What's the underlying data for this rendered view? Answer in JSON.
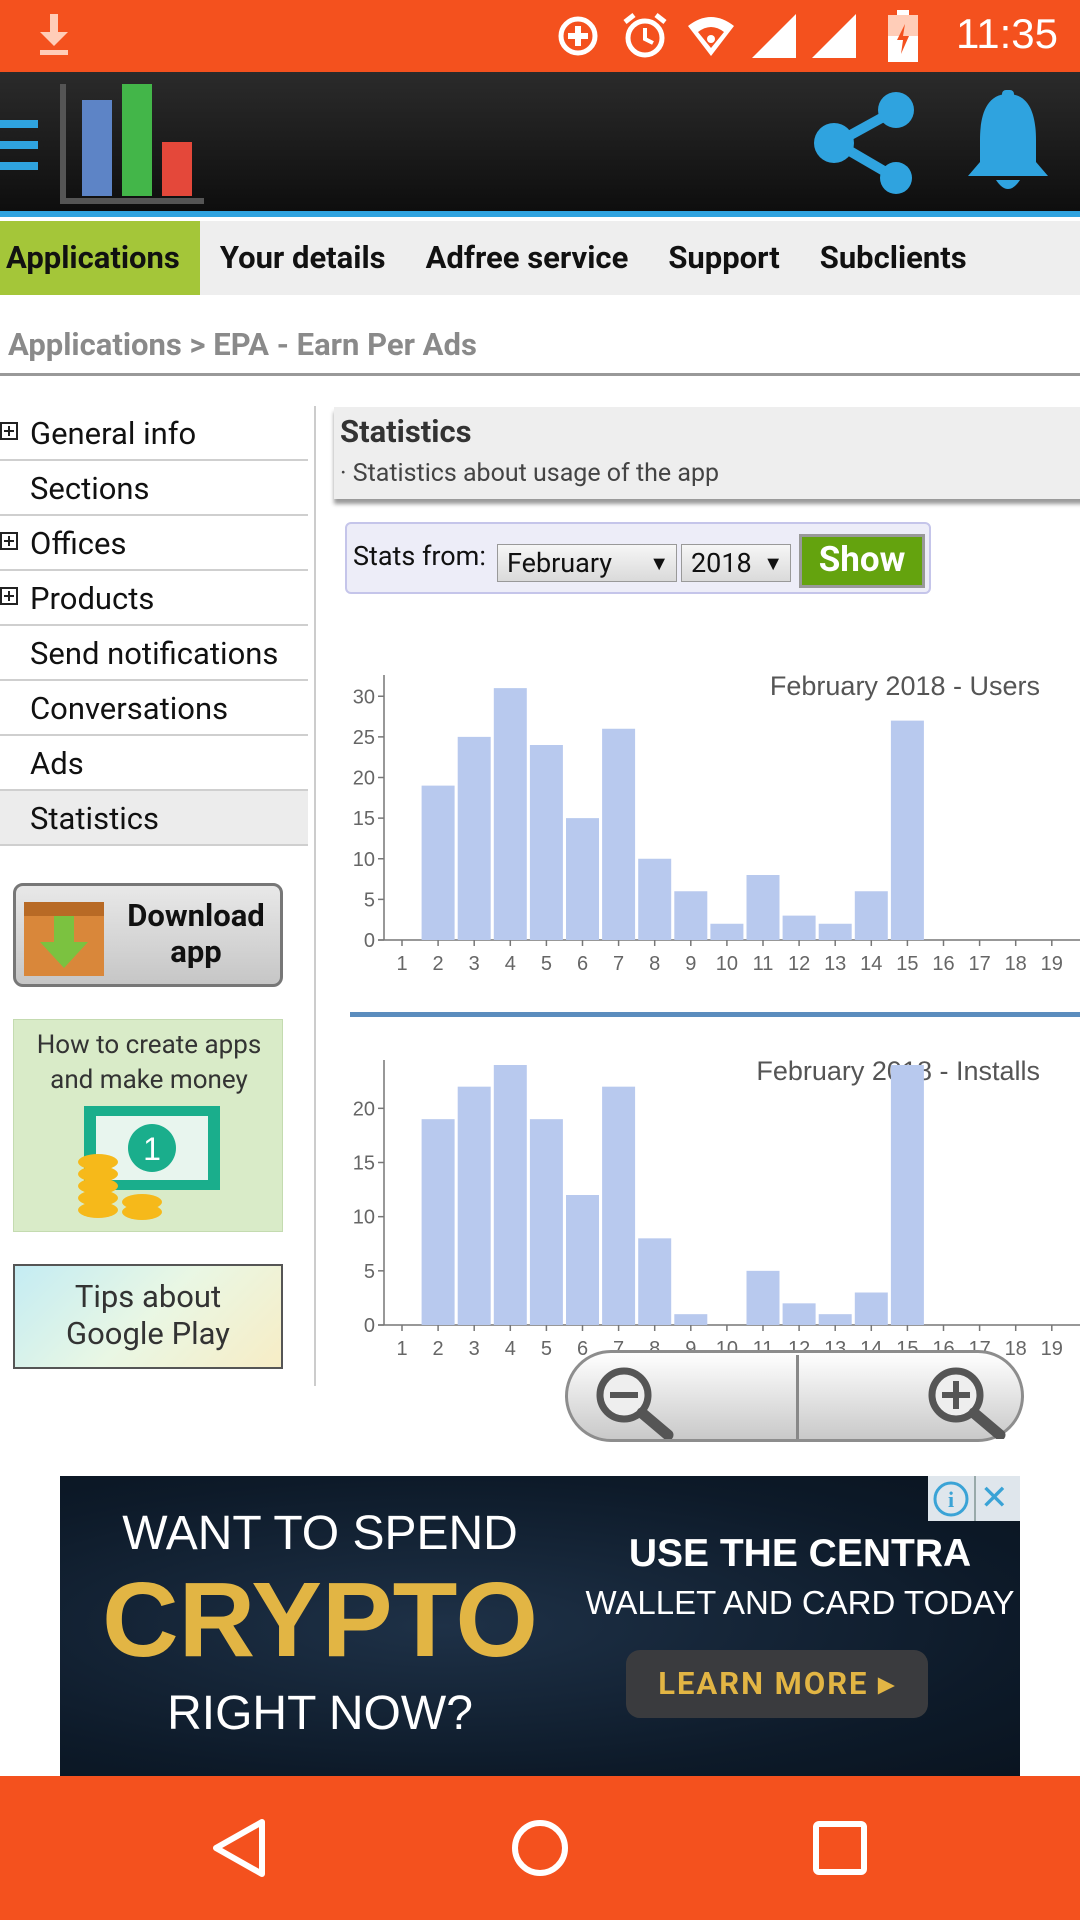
{
  "status_bar": {
    "time": "11:35",
    "icons": [
      "download-icon",
      "data-saver-icon",
      "alarm-icon",
      "wifi-icon",
      "signal-icon",
      "signal-icon",
      "battery-charging-icon"
    ]
  },
  "header": {
    "logo": "bar-chart-logo",
    "icons": [
      "menu-icon",
      "share-icon",
      "bell-icon"
    ]
  },
  "nav_tabs": [
    {
      "label": "Applications",
      "active": true
    },
    {
      "label": "Your details",
      "active": false
    },
    {
      "label": "Adfree service",
      "active": false
    },
    {
      "label": "Support",
      "active": false
    },
    {
      "label": "Subclients",
      "active": false
    }
  ],
  "breadcrumb": "Applications > EPA - Earn Per Ads",
  "sidebar": {
    "items": [
      {
        "label": "General info",
        "expandable": true
      },
      {
        "label": "Sections",
        "expandable": false
      },
      {
        "label": "Offices",
        "expandable": true
      },
      {
        "label": "Products",
        "expandable": true
      },
      {
        "label": "Send notifications",
        "expandable": false
      },
      {
        "label": "Conversations",
        "expandable": false
      },
      {
        "label": "Ads",
        "expandable": false
      },
      {
        "label": "Statistics",
        "expandable": false,
        "active": true
      }
    ],
    "download_button": "Download app",
    "download_line1": "Download",
    "download_line2": "app",
    "howto_line1": "How to create apps",
    "howto_line2": "and make money",
    "tips_line1": "Tips about",
    "tips_line2": "Google Play"
  },
  "stats_panel": {
    "title": "Statistics",
    "description": "· Statistics about usage of the app"
  },
  "stats_form": {
    "label": "Stats from:",
    "month": "February",
    "year": "2018",
    "arrow": "▼",
    "show_label": "Show"
  },
  "chart_data": [
    {
      "type": "bar",
      "title": "February 2018 - Users",
      "categories": [
        "1",
        "2",
        "3",
        "4",
        "5",
        "6",
        "7",
        "8",
        "9",
        "10",
        "11",
        "12",
        "13",
        "14",
        "15",
        "16",
        "17",
        "18",
        "19"
      ],
      "values": [
        0,
        19,
        25,
        31,
        24,
        15,
        26,
        10,
        6,
        2,
        8,
        3,
        2,
        6,
        27,
        0,
        0,
        0,
        0
      ],
      "yticks": [
        0,
        5,
        10,
        15,
        20,
        25,
        30
      ],
      "ylim": [
        0,
        32
      ],
      "color": "#b8c9ee"
    },
    {
      "type": "bar",
      "title": "February 2018 - Installs",
      "categories": [
        "1",
        "2",
        "3",
        "4",
        "5",
        "6",
        "7",
        "8",
        "9",
        "10",
        "11",
        "12",
        "13",
        "14",
        "15",
        "16",
        "17",
        "18",
        "19"
      ],
      "values": [
        0,
        19,
        22,
        24,
        19,
        12,
        22,
        8,
        1,
        0,
        5,
        2,
        1,
        3,
        24,
        0,
        0,
        0,
        0
      ],
      "yticks": [
        0,
        5,
        10,
        15,
        20
      ],
      "ylim": [
        0,
        24
      ],
      "color": "#b8c9ee"
    }
  ],
  "zoom": {
    "out_icon": "zoom-out-icon",
    "in_icon": "zoom-in-icon"
  },
  "ad": {
    "line1": "WANT TO SPEND",
    "line2": "CRYPTO",
    "line3": "RIGHT NOW?",
    "line4": "USE THE CENTRA",
    "line5": "WALLET AND CARD TODAY",
    "button": "LEARN MORE",
    "button_arrow": "▸",
    "close_label": "✕",
    "info_label": "i",
    "colors": {
      "gold": "#e2b544",
      "background": "#0d1a29"
    }
  },
  "nav_bar": {
    "icons": [
      "back-icon",
      "home-icon",
      "recents-icon"
    ]
  },
  "colors": {
    "status_bar": "#f4511e",
    "accent_green": "#a4c639",
    "accent_blue": "#2fa3df",
    "show_button": "#64a30e"
  }
}
